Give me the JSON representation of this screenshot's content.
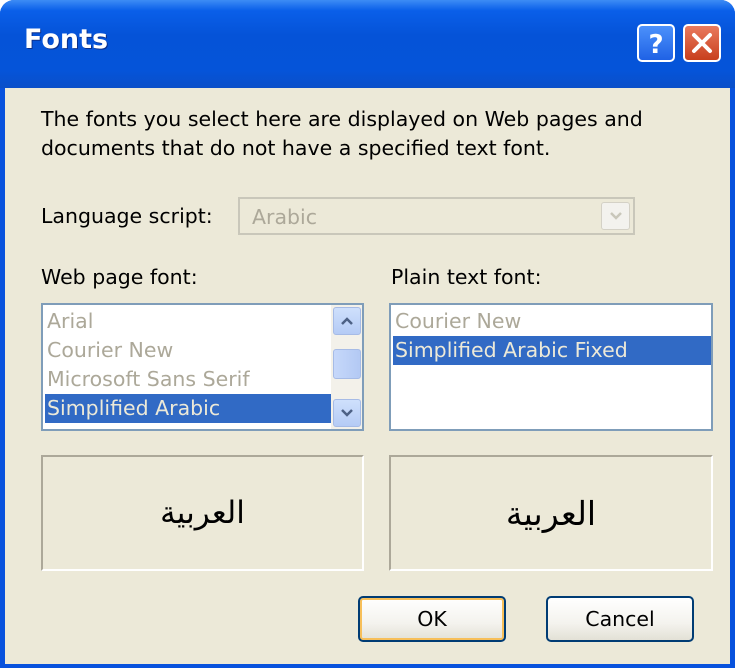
{
  "window": {
    "title": "Fonts",
    "help_icon": "question-mark-icon",
    "close_icon": "close-x-icon",
    "help_glyph": "?",
    "close_glyph": "✕"
  },
  "description": "The fonts you select here are displayed on Web pages and documents that do not have a specified text font.",
  "language": {
    "label": "Language script:",
    "value": "Arabic",
    "dropdown_icon": "chevron-down-icon"
  },
  "web_font": {
    "label": "Web page font:",
    "items": [
      "Arial",
      "Courier New",
      "Microsoft Sans Serif",
      "Simplified Arabic"
    ],
    "selected": "Simplified Arabic",
    "preview": "العربية"
  },
  "plain_font": {
    "label": "Plain text font:",
    "items": [
      "Courier New",
      "Simplified Arabic Fixed"
    ],
    "selected": "Simplified Arabic Fixed",
    "preview": "العربية"
  },
  "buttons": {
    "ok": "OK",
    "cancel": "Cancel"
  },
  "colors": {
    "titlebar": "#0554d9",
    "client_bg": "#ece9d8",
    "selection": "#316ac5",
    "disabled_text": "#aca899"
  }
}
